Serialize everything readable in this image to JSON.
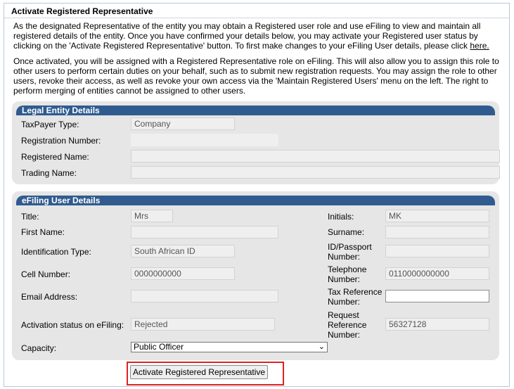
{
  "header": {
    "title": "Activate Registered Representative"
  },
  "intro": {
    "p1": "As the designated Representative of the entity you may obtain a Registered user role and use eFiling to view and maintain all registered details of the entity. Once you have confirmed your details below, you may activate your Registered user status by clicking on the 'Activate Registered Representative' button. To first make changes to your eFiling User details, please click ",
    "p1_link": "here.",
    "p2": "Once activated, you will be assigned with a Registered Representative role on eFiling. This will also allow you to assign this role to other users to perform certain duties on your behalf, such as to submit new registration requests. You may assign the role to other users, revoke their access, as well as revoke your own access via the 'Maintain Registered Users' menu on the left. The right to perform merging of entities cannot be assigned to other users."
  },
  "legal_entity": {
    "heading": "Legal Entity Details",
    "taxpayer_type_label": "TaxPayer Type:",
    "taxpayer_type_value": "Company",
    "registration_number_label": "Registration Number:",
    "registration_number_value": "",
    "registered_name_label": "Registered Name:",
    "registered_name_value": "",
    "trading_name_label": "Trading Name:",
    "trading_name_value": ""
  },
  "user": {
    "heading": "eFiling User Details",
    "title_label": "Title:",
    "title_value": "Mrs",
    "initials_label": "Initials:",
    "initials_value": "MK",
    "first_name_label": "First Name:",
    "first_name_value": "",
    "surname_label": "Surname:",
    "surname_value": "",
    "id_type_label": "Identification Type:",
    "id_type_value": "South African ID",
    "id_passport_label_1": "ID/Passport",
    "id_passport_label_2": "Number:",
    "id_passport_value": "",
    "cell_label": "Cell Number:",
    "cell_value": "0000000000",
    "tel_label_1": "Telephone",
    "tel_label_2": "Number:",
    "tel_value": "0110000000000",
    "email_label": "Email Address:",
    "email_value": "",
    "taxref_label_1": "Tax Reference",
    "taxref_label_2": "Number:",
    "taxref_value": "",
    "activation_label": "Activation status on eFiling:",
    "activation_value": "Rejected",
    "reqref_label_1": "Request",
    "reqref_label_2": "Reference",
    "reqref_label_3": "Number:",
    "reqref_value": "56327128",
    "capacity_label": "Capacity:",
    "capacity_value": "Public Officer"
  },
  "actions": {
    "activate_label": "Activate Registered Representative"
  }
}
